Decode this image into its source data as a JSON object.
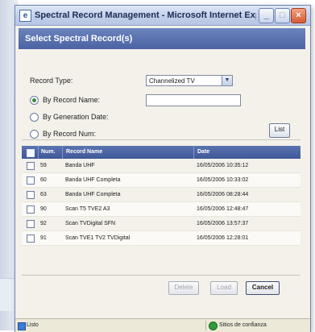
{
  "window": {
    "title": "Spectral Record Management - Microsoft Internet Explorer",
    "app_icon": "ie-page-icon",
    "controls": {
      "minimize": "_",
      "maximize": "□",
      "close": "×"
    }
  },
  "header": {
    "title": "Select Spectral Record(s)"
  },
  "form": {
    "record_type_label": "Record Type:",
    "record_type_value": "Channelized TV",
    "by_record_name_label": "By Record Name:",
    "by_generation_date_label": "By Generation Date:",
    "by_record_num_label": "By Record Num:",
    "list_button": "List"
  },
  "table": {
    "headers": {
      "num": "Num.",
      "name": "Record Name",
      "date": "Date"
    },
    "rows": [
      {
        "num": "59",
        "name": "Banda UHF",
        "date": "16/05/2006 10:35:12"
      },
      {
        "num": "60",
        "name": "Banda UHF Completa",
        "date": "16/05/2006 10:33:02"
      },
      {
        "num": "63",
        "name": "Banda UHF Completa",
        "date": "16/05/2006 08:28:44"
      },
      {
        "num": "90",
        "name": "Scan T5 TVE2 A3",
        "date": "16/05/2006 12:48:47"
      },
      {
        "num": "92",
        "name": "Scan TVDigital SFN",
        "date": "16/05/2006 13:57:37"
      },
      {
        "num": "91",
        "name": "Scan TVE1 TV2 TVDigital",
        "date": "16/05/2006 12:28:01"
      }
    ]
  },
  "buttons": {
    "delete": "Delete",
    "load": "Load",
    "cancel": "Cancel"
  },
  "statusbar": {
    "left": "Listo",
    "right": "Sitios de confianza"
  }
}
